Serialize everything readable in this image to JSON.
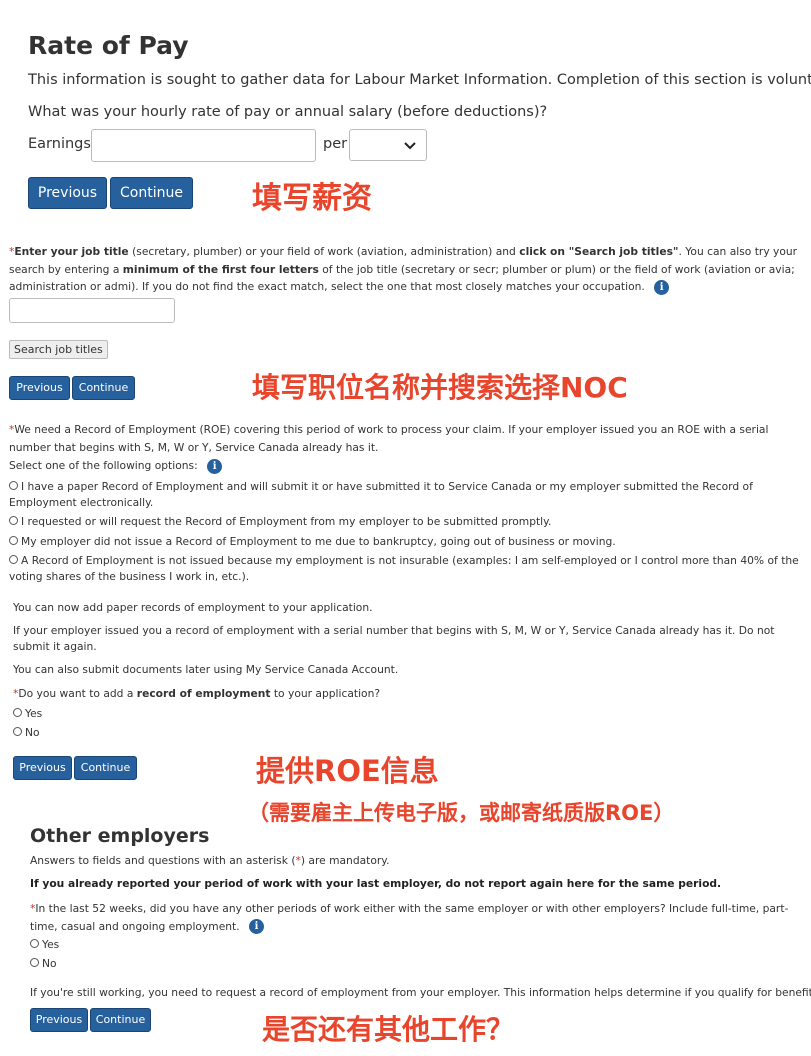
{
  "rate_of_pay": {
    "title": "Rate of Pay",
    "info": "This information is sought to gather data for Labour Market Information. Completion of this section is voluntary.",
    "question": "What was your hourly rate of pay or annual salary (before deductions)?",
    "earnings_label": "Earnings",
    "earnings_value": "",
    "per_label": "per",
    "per_value": "",
    "previous": "Previous",
    "continue": "Continue",
    "annotation": "填写薪资"
  },
  "job_title": {
    "req": "*",
    "p1": "Enter your job title",
    "p2": " (secretary, plumber) or your field of work (aviation, administration) and ",
    "p3": "click on \"Search job titles\"",
    "p4": ". You can also try your search by entering a ",
    "p5": "minimum of the first four letters",
    "p6": " of the job title (secretary or secr; plumber or plum) or the field of work (aviation or avia; administration or admi). If you do not find the exact match, select the one that most closely matches your occupation.",
    "input_value": "",
    "search_button": "Search job titles",
    "previous": "Previous",
    "continue": "Continue",
    "annotation": "填写职位名称并搜索选择NOC"
  },
  "roe": {
    "req": "*",
    "intro": "We need a Record of Employment (ROE) covering this period of work to process your claim. If your employer issued you an ROE with a serial number that begins with S, M, W or Y, Service Canada already has it.",
    "select_label": "Select one of the following options:",
    "options": [
      "I have a paper Record of Employment and will submit it or have submitted it to Service Canada or my employer submitted the Record of Employment electronically.",
      "I requested or will request the Record of Employment from my employer to be submitted promptly.",
      "My employer did not issue a Record of Employment to me due to bankruptcy, going out of business or moving.",
      "A Record of Employment is not issued because my employment is not insurable (examples: I am self-employed or I control more than 40% of the voting shares of the business I work in, etc.)."
    ]
  },
  "add_roe": {
    "line1": "You can now add paper records of employment to your application.",
    "line2": "If your employer issued you a record of employment with a serial number that begins with S, M, W or Y, Service Canada already has it. Do not submit it again.",
    "line3": "You can also submit documents later using My Service Canada Account.",
    "req": "*",
    "q1": "Do you want to add a ",
    "q2": "record of employment",
    "q3": " to your application?",
    "yes": "Yes",
    "no": "No",
    "previous": "Previous",
    "continue": "Continue",
    "annotation1": "提供ROE信息",
    "annotation2": "（需要雇主上传电子版，或邮寄纸质版ROE）"
  },
  "other_employers": {
    "title": "Other employers",
    "mandatory_1": "Answers to fields and questions with an asterisk (",
    "mandatory_star": "*",
    "mandatory_2": ") are mandatory.",
    "bold_note": "If you already reported your period of work with your last employer, do not report again here for the same period.",
    "req": "*",
    "question": "In the last 52 weeks, did you have any other periods of work either with the same employer or with other employers? Include full-time, part-time, casual and ongoing employment.",
    "yes": "Yes",
    "no": "No",
    "still_working": "If you're still working, you need to request a record of employment from your employer. This information helps determine if you qualify for benefits.",
    "previous": "Previous",
    "continue": "Continue",
    "annotation": "是否还有其他工作？"
  }
}
